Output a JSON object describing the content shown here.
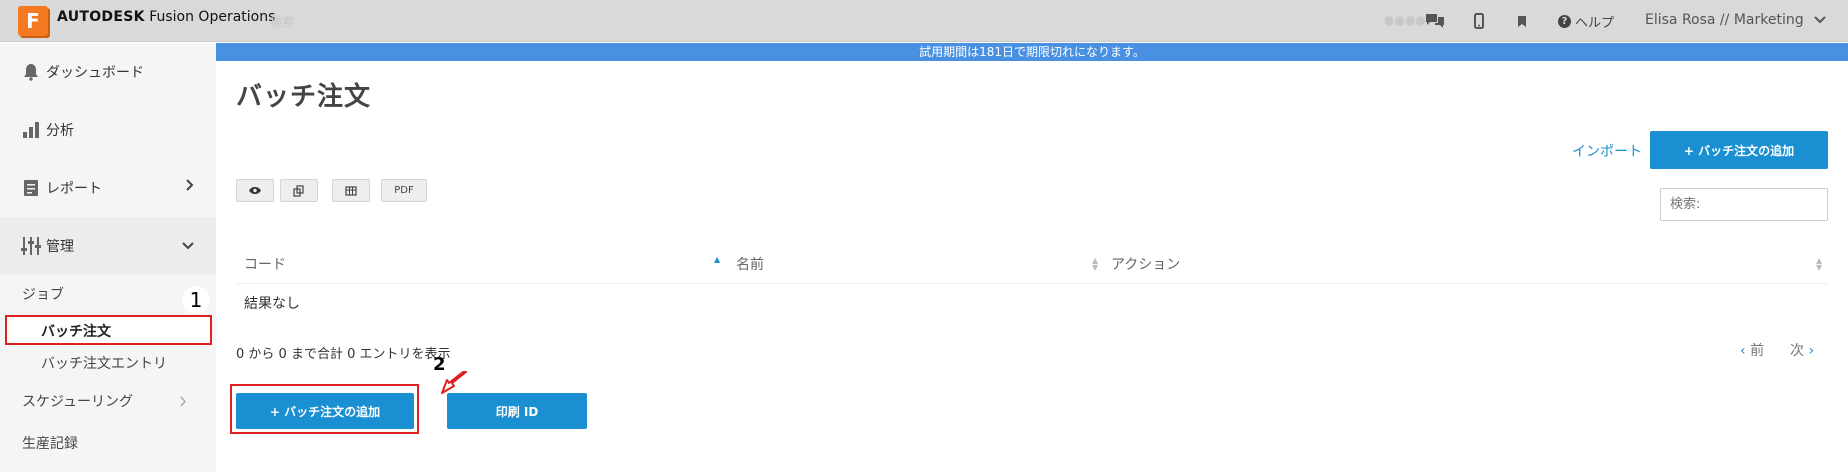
{
  "app": {
    "brand_bold": "AUTODESK",
    "brand_name": "Fusion Operations",
    "logo_letter": "F",
    "search_ghost": "検索",
    "ghost_right": "●●●●",
    "help_label": "ヘルプ",
    "user_label": "Elisa Rosa // Marketing"
  },
  "colors": {
    "accent": "#1a8fd1",
    "banner": "#4a90e2",
    "logo": "#f47920",
    "highlight": "#e02020"
  },
  "sidebar": {
    "items": [
      {
        "label": "ダッシュボード",
        "icon": "bell-icon"
      },
      {
        "label": "分析",
        "icon": "bar-chart-icon"
      },
      {
        "label": "レポート",
        "icon": "document-icon"
      },
      {
        "label": "管理",
        "icon": "sliders-icon"
      }
    ],
    "sub": {
      "jobs": "ジョブ",
      "batch_order": "バッチ注文",
      "batch_entry": "バッチ注文エントリ",
      "scheduling": "スケジューリング",
      "production_records": "生産記録"
    },
    "badge": "1"
  },
  "main": {
    "banner": "試用期間は181日で期限切れになります。",
    "title": "バッチ注文",
    "import_label": "インポート",
    "add_label": "+ バッチ注文の追加",
    "tool_pdf": "PDF",
    "search_placeholder": "検索:",
    "table": {
      "headers": [
        "コード",
        "名前",
        "アクション"
      ],
      "empty": "結果なし"
    },
    "info": "0 から 0 まで合計 0 エントリを表示",
    "prev": "前",
    "next": "次",
    "bottom_add_label": "+ バッチ注文の追加",
    "print_id_label": "印刷 ID",
    "badge2": "2"
  }
}
